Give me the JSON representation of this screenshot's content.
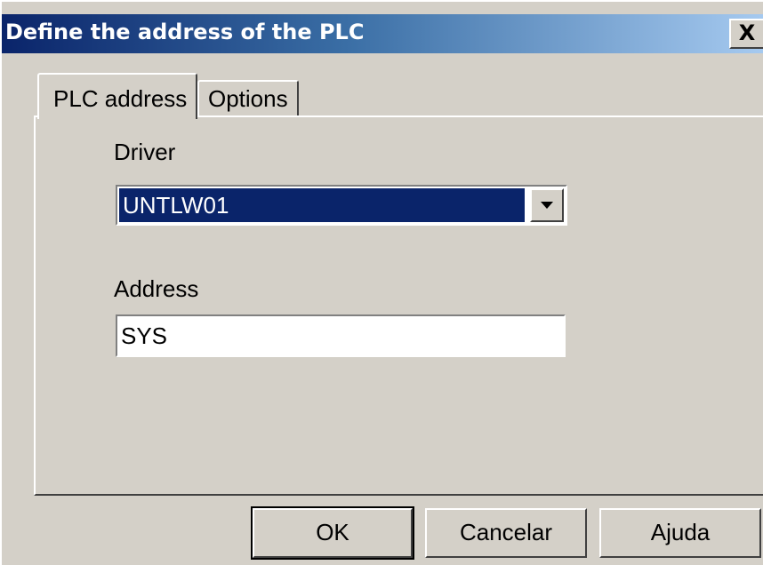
{
  "dialog": {
    "title": "Define the address of the PLC",
    "close_label": "X"
  },
  "tabs": [
    {
      "label": "PLC address",
      "selected": true
    },
    {
      "label": "Options",
      "selected": false
    }
  ],
  "form": {
    "driver_label": "Driver",
    "driver_value": "UNTLW01",
    "address_label": "Address",
    "address_value": "SYS"
  },
  "buttons": {
    "ok_label": "OK",
    "cancel_label": "Cancelar",
    "help_label": "Ajuda"
  },
  "icons": {
    "dropdown": "chevron-down-icon",
    "close": "close-icon"
  },
  "colors": {
    "title_start": "#0a246a",
    "title_end": "#a6caf0",
    "selection": "#0a246a",
    "face": "#d4d0c8"
  }
}
